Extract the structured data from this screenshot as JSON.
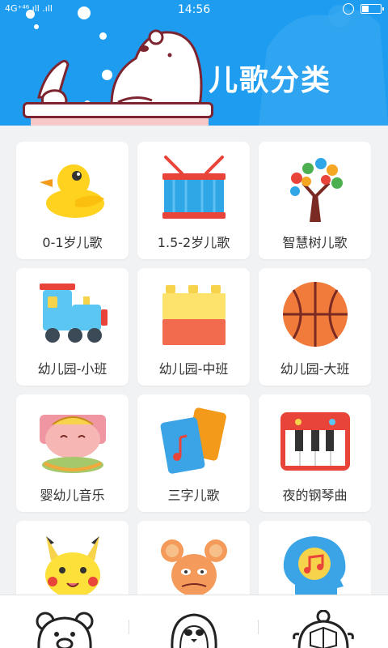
{
  "status_bar": {
    "signal": "4G⁺⁴⁶.ıll .ıll",
    "time": "14:56",
    "battery_level": 0.4
  },
  "header": {
    "title": "儿歌分类",
    "background_color": "#1e9df0"
  },
  "categories": [
    {
      "label": "0-1岁儿歌",
      "icon": "duck-icon"
    },
    {
      "label": "1.5-2岁儿歌",
      "icon": "drum-icon"
    },
    {
      "label": "智慧树儿歌",
      "icon": "tree-icon"
    },
    {
      "label": "幼儿园-小班",
      "icon": "train-icon"
    },
    {
      "label": "幼儿园-中班",
      "icon": "blocks-icon"
    },
    {
      "label": "幼儿园-大班",
      "icon": "basketball-icon"
    },
    {
      "label": "婴幼儿音乐",
      "icon": "baby-icon"
    },
    {
      "label": "三字儿歌",
      "icon": "music-cards-icon"
    },
    {
      "label": "夜的钢琴曲",
      "icon": "piano-icon"
    },
    {
      "label": "",
      "icon": "pikachu-icon"
    },
    {
      "label": "",
      "icon": "mouse-icon"
    },
    {
      "label": "",
      "icon": "head-music-icon"
    }
  ],
  "bottom_nav": [
    {
      "icon": "bear-icon"
    },
    {
      "icon": "penguin-icon"
    },
    {
      "icon": "turtle-icon"
    }
  ]
}
